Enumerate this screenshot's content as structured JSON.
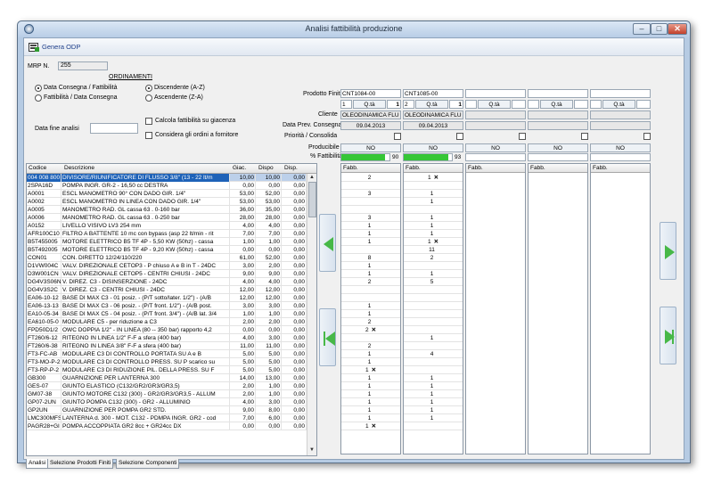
{
  "window": {
    "title": "Analisi fattibilità produzione",
    "close_glyph": "✕",
    "min_glyph": "–",
    "max_glyph": "□"
  },
  "toolbar": {
    "genera_label": "Genera ODP"
  },
  "mrp": {
    "label": "MRP N.",
    "value": "255"
  },
  "ordinamenti": {
    "title": "ORDINAMENTI",
    "options": [
      "Data Consegna / Fattibilità",
      "Fattibilità / Data Consegna"
    ],
    "selected_option": 0,
    "directions": [
      "Discendente (A-Z)",
      "Ascendente (Z-A)"
    ],
    "selected_direction": 0
  },
  "data_fine_analisi": {
    "label": "Data fine analisi",
    "value": ""
  },
  "checks": {
    "giacenza": "Calcola fattibilità su giacenza",
    "fornitore": "Considera gli ordini a fornitore"
  },
  "right_labels": {
    "prodotto": "Prodotto Finito",
    "cliente": "Cliente",
    "data_prev": "Data Prev. Consegna",
    "priorita": "Priorità / Consolida",
    "producibile": "Producibile",
    "fattibilita": "% Fattibilità"
  },
  "products": [
    {
      "code": "CNT1084-00",
      "qty": "1",
      "qta_label": "Q.tà",
      "qta_val": "1",
      "cliente": "OLEODINAMICA FLU",
      "data": "09.04.2013",
      "producibile": "NO",
      "fatt": "90",
      "fatt_pct": 90
    },
    {
      "code": "CNT1085-00",
      "qty": "2",
      "qta_label": "Q.tà",
      "qta_val": "1",
      "cliente": "OLEODINAMICA FLU",
      "data": "09.04.2013",
      "producibile": "NO",
      "fatt": "93",
      "fatt_pct": 93
    },
    {
      "code": "",
      "qty": "",
      "qta_label": "Q.tà",
      "qta_val": "",
      "cliente": "",
      "data": "",
      "producibile": "NO",
      "fatt": "",
      "fatt_pct": 0
    },
    {
      "code": "",
      "qty": "",
      "qta_label": "Q.tà",
      "qta_val": "",
      "cliente": "",
      "data": "",
      "producibile": "NO",
      "fatt": "",
      "fatt_pct": 0
    },
    {
      "code": "",
      "qty": "",
      "qta_label": "Q.tà",
      "qta_val": "",
      "cliente": "",
      "data": "",
      "producibile": "NO",
      "fatt": "",
      "fatt_pct": 0
    }
  ],
  "grid": {
    "headers": [
      "Codice",
      "Descrizione",
      "Giac.",
      "Dispo",
      "Disp."
    ],
    "rows": [
      [
        "004 008 800",
        "DIVISORE/RIUNIFICATORE DI FLUSSO 3/8\" (13 - 22 lt/m",
        "10,00",
        "10,00",
        "0,00"
      ],
      [
        "2SPA16D",
        "POMPA INGR. GR-2 - 16,50 cc DESTRA",
        "0,00",
        "0,00",
        "0,00"
      ],
      [
        "A0001",
        "ESCL MANOMETRO 90° CON DADO GIR. 1/4\"",
        "53,00",
        "52,00",
        "0,00"
      ],
      [
        "A0002",
        "ESCL MANOMETRO IN LINEA CON DADO GIR. 1/4\"",
        "53,00",
        "53,00",
        "0,00"
      ],
      [
        "A0005",
        "MANOMETRO RAD. GL cassa 63 . 0-160 bar",
        "36,00",
        "35,00",
        "0,00"
      ],
      [
        "A0006",
        "MANOMETRO RAD. GL cassa 63 . 0-250 bar",
        "28,00",
        "28,00",
        "0,00"
      ],
      [
        "A0152",
        "LIVELLO VISIVO LV3  254 mm",
        "4,00",
        "4,00",
        "0,00"
      ],
      [
        "AFR100C10",
        "FILTRO A BATTENTE 10 mc con bypass (asp 22 lt/min - rit",
        "7,00",
        "7,00",
        "0,00"
      ],
      [
        "B5T455005",
        "MOTORE ELETTRICO B5 TF 4P - 5,50 KW (50hz) - cassa",
        "1,00",
        "1,00",
        "0,00"
      ],
      [
        "B5T492005",
        "MOTORE ELETTRICO B5 TF 4P - 9,20 KW (50hz) - cassa",
        "0,00",
        "0,00",
        "0,00"
      ],
      [
        "CON01",
        "CON. DIRETTO 12/24/110/220",
        "61,00",
        "52,00",
        "0,00"
      ],
      [
        "D1VW004C",
        "VALV. DIREZIONALE CETOP3 - P chiuso A e B in T - 24DC",
        "3,00",
        "2,00",
        "0,00"
      ],
      [
        "D3W001CN",
        "VALV. DIREZIONALE CETOP5 - CENTRI CHIUSI - 24DC",
        "9,00",
        "9,00",
        "0,00"
      ],
      [
        "DG4V3S06N",
        "V. DIREZ. C3 - DISINSERZIONE - 24DC",
        "4,00",
        "4,00",
        "0,00"
      ],
      [
        "DG4V3S2C",
        "V. DIREZ. C3 - CENTRI CHIUSI - 24DC",
        "12,00",
        "12,00",
        "0,00"
      ],
      [
        "EA06-10-12",
        "BASE DI MAX C3 - 01 posiz. - (P/T sotto/later. 1/2\") - (A/B",
        "12,00",
        "12,00",
        "0,00"
      ],
      [
        "EA06-13-13",
        "BASE DI MAX C3 - 06 posiz. - (P/T front. 1/2\") - (A/B post.",
        "3,00",
        "3,00",
        "0,00"
      ],
      [
        "EA10-05-34",
        "BASE DI MAX C5 - 04 posiz. - (P/T front. 3/4\") - (A/B lat. 3/4",
        "1,00",
        "1,00",
        "0,00"
      ],
      [
        "EA610-05-0",
        "MODULARE C5 - per riduzione a C3",
        "2,00",
        "2,00",
        "0,00"
      ],
      [
        "FPD50D1/2",
        "OWC DOPPIA 1/2\" - IN LINEA (80 -- 350 bar) rapporto 4,2",
        "0,00",
        "0,00",
        "0,00"
      ],
      [
        "FT260/6-12",
        "RITEGNO IN LINEA 1/2\" F-F a sfera (400 bar)",
        "4,00",
        "3,00",
        "0,00"
      ],
      [
        "FT260/6-38",
        "RITEGNO IN LINEA 3/8\" F-F a sfera (400 bar)",
        "11,00",
        "11,00",
        "0,00"
      ],
      [
        "FT3-FC-AB",
        "MODULARE C3 DI CONTROLLO PORTATA SU A e B",
        "5,00",
        "5,00",
        "0,00"
      ],
      [
        "FT3-MO-P-2",
        "MODULARE C3 DI CONTROLLO PRESS. SU P scarico su",
        "5,00",
        "5,00",
        "0,00"
      ],
      [
        "FT3-RP-P-2",
        "MODULARE C3 DI RIDUZIONE PIL. DELLA PRESS. SU F",
        "5,00",
        "5,00",
        "0,00"
      ],
      [
        "GB300",
        "GUARNIZIONE PER LANTERNA 300",
        "14,00",
        "13,00",
        "0,00"
      ],
      [
        "GES-07",
        "GIUNTO ELASTICO (C132/GR2/GR3/GR3,5)",
        "2,00",
        "1,00",
        "0,00"
      ],
      [
        "GM07-38",
        "GIUNTO MOTORE C132 (300) - GR2/GR3/GR3,5 - ALLUM",
        "2,00",
        "1,00",
        "0,00"
      ],
      [
        "GP07-2UN",
        "GIUNTO POMPA C132 (300) - GR2 - ALLUMINIO",
        "4,00",
        "3,00",
        "0,00"
      ],
      [
        "GP2UN",
        "GUARNIZIONE PER POMPA GR2 STD.",
        "9,00",
        "8,00",
        "0,00"
      ],
      [
        "LMC300MFS",
        "LANTERNA d. 300 - MOT. C132 - PDMPA INGR. GR2 - cod",
        "7,00",
        "6,00",
        "0,00"
      ],
      [
        "PAGR28+GI",
        "POMPA ACCOPPIATA GR2 8cc + GR24cc DX",
        "0,00",
        "0,00",
        "0,00"
      ]
    ]
  },
  "fabb_header": "Fabb.",
  "fabb": [
    [
      [
        "2",
        ""
      ],
      [
        "",
        ""
      ],
      [
        "3",
        ""
      ],
      [
        "",
        ""
      ],
      [
        "",
        ""
      ],
      [
        "3",
        ""
      ],
      [
        "1",
        ""
      ],
      [
        "1",
        ""
      ],
      [
        "1",
        ""
      ],
      [
        "",
        ""
      ],
      [
        "8",
        ""
      ],
      [
        "1",
        ""
      ],
      [
        "1",
        ""
      ],
      [
        "2",
        ""
      ],
      [
        "",
        ""
      ],
      [
        "",
        ""
      ],
      [
        "1",
        ""
      ],
      [
        "1",
        ""
      ],
      [
        "2",
        ""
      ],
      [
        "2",
        "✕"
      ],
      [
        "",
        ""
      ],
      [
        "2",
        ""
      ],
      [
        "1",
        ""
      ],
      [
        "1",
        ""
      ],
      [
        "1",
        "✕"
      ],
      [
        "1",
        ""
      ],
      [
        "1",
        ""
      ],
      [
        "1",
        ""
      ],
      [
        "1",
        ""
      ],
      [
        "1",
        ""
      ],
      [
        "1",
        ""
      ],
      [
        "1",
        "✕"
      ]
    ],
    [
      [
        "1",
        "✕"
      ],
      [
        "",
        ""
      ],
      [
        "1",
        ""
      ],
      [
        "1",
        ""
      ],
      [
        "",
        ""
      ],
      [
        "1",
        ""
      ],
      [
        "1",
        ""
      ],
      [
        "1",
        ""
      ],
      [
        "1",
        "✕"
      ],
      [
        "11",
        ""
      ],
      [
        "2",
        ""
      ],
      [
        "",
        ""
      ],
      [
        "1",
        ""
      ],
      [
        "5",
        ""
      ],
      [
        "",
        ""
      ],
      [
        "",
        ""
      ],
      [
        "",
        ""
      ],
      [
        "",
        ""
      ],
      [
        "",
        ""
      ],
      [
        "",
        ""
      ],
      [
        "1",
        ""
      ],
      [
        "",
        ""
      ],
      [
        "4",
        ""
      ],
      [
        "",
        ""
      ],
      [
        "",
        ""
      ],
      [
        "1",
        ""
      ],
      [
        "1",
        ""
      ],
      [
        "1",
        ""
      ],
      [
        "1",
        ""
      ],
      [
        "1",
        ""
      ],
      [
        "1",
        ""
      ],
      [
        "",
        ""
      ]
    ],
    [],
    [],
    []
  ],
  "tabs": [
    "Analisi",
    "Selezione Prodotti Finiti",
    "Selezione Componenti"
  ],
  "icons": {
    "left_arrow": "left-arrow-icon",
    "right_arrow": "right-arrow-icon",
    "first": "first-icon",
    "last": "last-icon"
  },
  "colors": {
    "progress": "#36c636",
    "selection": "#1e62b8",
    "arrow": "#47b847"
  }
}
